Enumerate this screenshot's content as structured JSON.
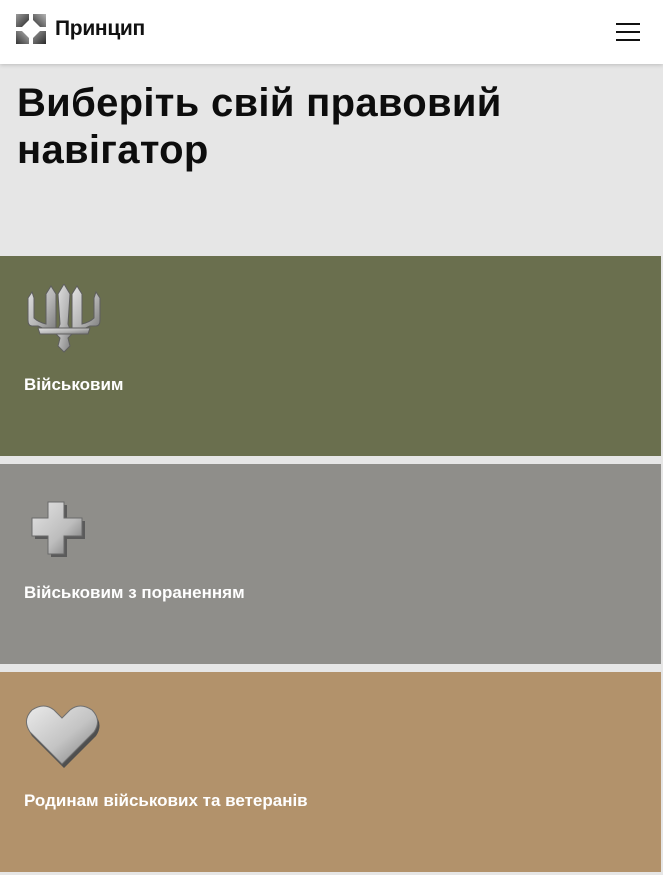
{
  "header": {
    "brand_name": "Принцип",
    "logo_icon": "principle-logo-icon",
    "menu_icon": "hamburger-menu-icon"
  },
  "hero": {
    "title_line1": "Виберіть свій правовий",
    "title_line2": "навігатор"
  },
  "cards": [
    {
      "label": "Військовим",
      "icon": "trident-icon",
      "color": "#6a6f4e"
    },
    {
      "label": "Військовим з пораненням",
      "icon": "cross-icon",
      "color": "#8f8e8a"
    },
    {
      "label": "Родинам військових та ветеранів",
      "icon": "heart-icon",
      "color": "#b2926b"
    }
  ],
  "colors": {
    "page_background": "#e6e6e6",
    "header_background": "#ffffff",
    "text_dark": "#0d0d0d",
    "card_text": "#ffffff"
  }
}
